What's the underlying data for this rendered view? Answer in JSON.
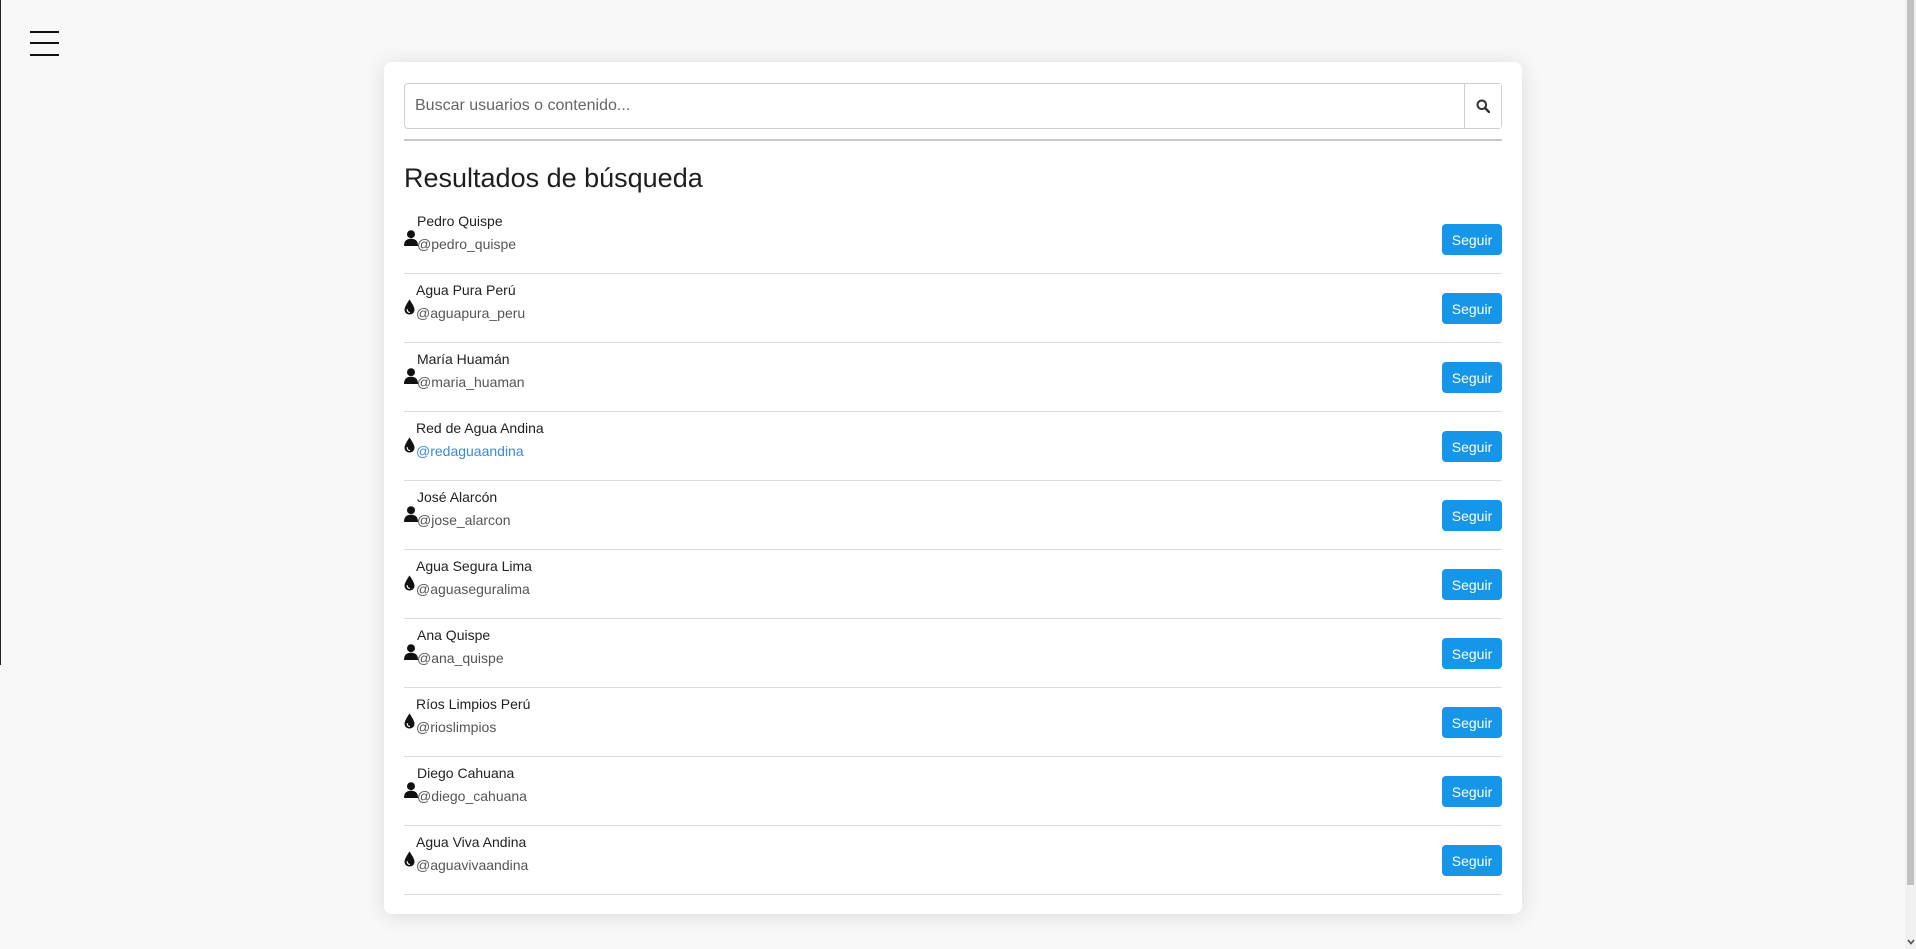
{
  "search": {
    "placeholder": "Buscar usuarios o contenido...",
    "value": ""
  },
  "results": {
    "title": "Resultados de búsqueda",
    "follow_label": "Seguir",
    "items": [
      {
        "name": "Pedro Quispe",
        "handle": "@pedro_quispe",
        "icon": "user-icon"
      },
      {
        "name": "Agua Pura Perú",
        "handle": "@aguapura_peru",
        "icon": "water-drop-icon"
      },
      {
        "name": "María Huamán",
        "handle": "@maria_huaman",
        "icon": "user-icon"
      },
      {
        "name": "Red de Agua Andina",
        "handle": "@redaguaandina",
        "icon": "water-drop-icon"
      },
      {
        "name": "José Alarcón",
        "handle": "@jose_alarcon",
        "icon": "user-icon"
      },
      {
        "name": "Agua Segura Lima",
        "handle": "@aguaseguralima",
        "icon": "water-drop-icon"
      },
      {
        "name": "Ana Quispe",
        "handle": "@ana_quispe",
        "icon": "user-icon"
      },
      {
        "name": "Ríos Limpios Perú",
        "handle": "@rioslimpios",
        "icon": "water-drop-icon"
      },
      {
        "name": "Diego Cahuana",
        "handle": "@diego_cahuana",
        "icon": "user-icon"
      },
      {
        "name": "Agua Viva Andina",
        "handle": "@aguavivaandina",
        "icon": "water-drop-icon"
      }
    ]
  },
  "colors": {
    "accent": "#1596e8",
    "highlighted_handle": "#3a8ad8"
  }
}
